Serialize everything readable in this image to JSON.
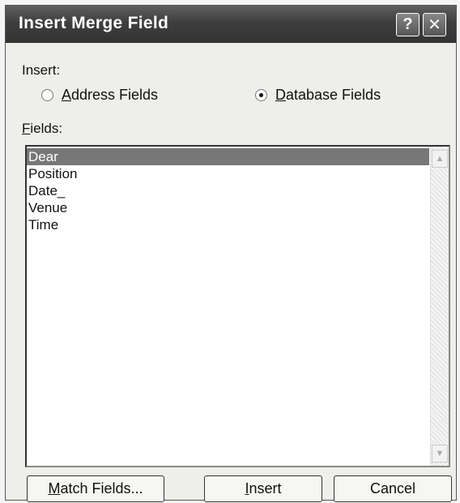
{
  "window": {
    "title": "Insert Merge Field",
    "help_label": "?",
    "close_label": "✕"
  },
  "insert": {
    "label": "Insert:",
    "options": [
      {
        "first": "A",
        "rest": "ddress Fields",
        "selected": false
      },
      {
        "first": "D",
        "rest": "atabase Fields",
        "selected": true
      }
    ]
  },
  "fields": {
    "label_first": "F",
    "label_rest": "ields:",
    "items": [
      "Dear",
      "Position",
      "Date_",
      "Venue",
      "Time"
    ],
    "selected_index": 0
  },
  "buttons": {
    "match_first": "M",
    "match_rest": "atch Fields...",
    "insert_first": "I",
    "insert_rest": "nsert",
    "cancel": "Cancel"
  },
  "icons": {
    "scroll_up": "scroll-up-arrow-icon",
    "scroll_down": "scroll-down-arrow-icon"
  }
}
